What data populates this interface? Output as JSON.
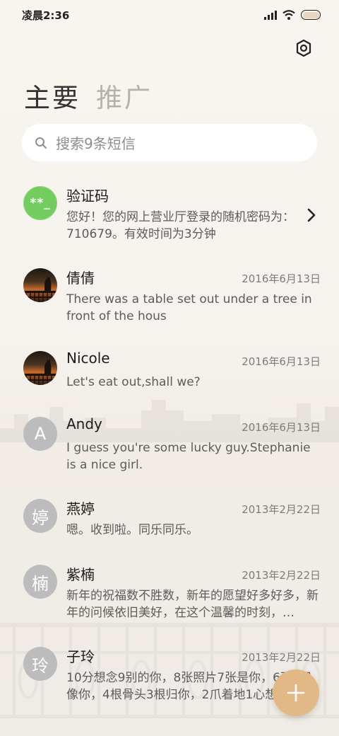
{
  "status_bar": {
    "time": "凌晨2:36",
    "icons": [
      "signal-icon",
      "wifi-icon",
      "battery-icon"
    ]
  },
  "header": {
    "settings_icon": "settings-icon",
    "tabs": [
      {
        "label": "主要",
        "active": true
      },
      {
        "label": "推广",
        "active": false
      }
    ]
  },
  "search": {
    "placeholder": "搜索9条短信",
    "icon": "search-icon"
  },
  "messages": [
    {
      "sender": "验证码",
      "avatar_text": "**_",
      "avatar_style": "green",
      "date": "",
      "preview": "您好！您的网上营业厅登录的随机密码为：710679。有效时间为3分钟",
      "has_chevron": true
    },
    {
      "sender": "倩倩",
      "avatar_text": "",
      "avatar_style": "photo",
      "date": "2016年6月13日",
      "preview": "There was a table set out under a tree in front of the hous"
    },
    {
      "sender": "Nicole",
      "avatar_text": "",
      "avatar_style": "photo",
      "date": "2016年6月13日",
      "preview": "Let's eat out,shall we?"
    },
    {
      "sender": "Andy",
      "avatar_text": "A",
      "avatar_style": "gray",
      "date": "2016年6月13日",
      "preview": "I guess you're some lucky guy.Stephanie is a nice girl."
    },
    {
      "sender": "燕婷",
      "avatar_text": "婷",
      "avatar_style": "gray",
      "date": "2013年2月22日",
      "preview": "嗯。收到啦。同乐同乐。"
    },
    {
      "sender": "紫楠",
      "avatar_text": "楠",
      "avatar_style": "gray",
      "date": "2013年2月22日",
      "preview": "新年的祝福数不胜数，新年的愿望好多好多，新年的问候依旧美好，在这个温馨的时刻，…"
    },
    {
      "sender": "子玲",
      "avatar_text": "玲",
      "avatar_style": "gray",
      "date": "2013年2月22日",
      "preview": "10分想念9别的你，8张照片7张是你，6不5只像你，4根骨头3根归你，2爪着地1心想你。"
    }
  ],
  "fab": {
    "icon": "plus-icon",
    "color": "#e2b886"
  },
  "colors": {
    "accent": "#e2b886",
    "verification_avatar": "#72cc5e",
    "letter_avatar": "#bcbcbc"
  }
}
